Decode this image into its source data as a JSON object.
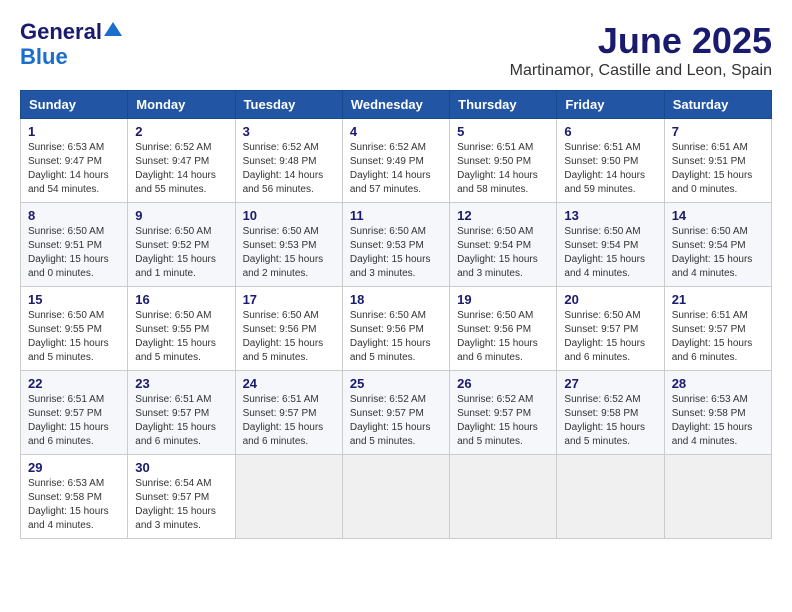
{
  "header": {
    "logo_line1": "General",
    "logo_line2": "Blue",
    "main_title": "June 2025",
    "subtitle": "Martinamor, Castille and Leon, Spain"
  },
  "calendar": {
    "headers": [
      "Sunday",
      "Monday",
      "Tuesday",
      "Wednesday",
      "Thursday",
      "Friday",
      "Saturday"
    ],
    "weeks": [
      [
        null,
        {
          "day": "2",
          "info": "Sunrise: 6:52 AM\nSunset: 9:47 PM\nDaylight: 14 hours\nand 55 minutes."
        },
        {
          "day": "3",
          "info": "Sunrise: 6:52 AM\nSunset: 9:48 PM\nDaylight: 14 hours\nand 56 minutes."
        },
        {
          "day": "4",
          "info": "Sunrise: 6:52 AM\nSunset: 9:49 PM\nDaylight: 14 hours\nand 57 minutes."
        },
        {
          "day": "5",
          "info": "Sunrise: 6:51 AM\nSunset: 9:50 PM\nDaylight: 14 hours\nand 58 minutes."
        },
        {
          "day": "6",
          "info": "Sunrise: 6:51 AM\nSunset: 9:50 PM\nDaylight: 14 hours\nand 59 minutes."
        },
        {
          "day": "7",
          "info": "Sunrise: 6:51 AM\nSunset: 9:51 PM\nDaylight: 15 hours\nand 0 minutes."
        }
      ],
      [
        {
          "day": "1",
          "info": "Sunrise: 6:53 AM\nSunset: 9:47 PM\nDaylight: 14 hours\nand 54 minutes."
        },
        {
          "day": "9",
          "info": "Sunrise: 6:50 AM\nSunset: 9:52 PM\nDaylight: 15 hours\nand 1 minute."
        },
        {
          "day": "10",
          "info": "Sunrise: 6:50 AM\nSunset: 9:53 PM\nDaylight: 15 hours\nand 2 minutes."
        },
        {
          "day": "11",
          "info": "Sunrise: 6:50 AM\nSunset: 9:53 PM\nDaylight: 15 hours\nand 3 minutes."
        },
        {
          "day": "12",
          "info": "Sunrise: 6:50 AM\nSunset: 9:54 PM\nDaylight: 15 hours\nand 3 minutes."
        },
        {
          "day": "13",
          "info": "Sunrise: 6:50 AM\nSunset: 9:54 PM\nDaylight: 15 hours\nand 4 minutes."
        },
        {
          "day": "14",
          "info": "Sunrise: 6:50 AM\nSunset: 9:54 PM\nDaylight: 15 hours\nand 4 minutes."
        }
      ],
      [
        {
          "day": "8",
          "info": "Sunrise: 6:50 AM\nSunset: 9:51 PM\nDaylight: 15 hours\nand 0 minutes."
        },
        {
          "day": "16",
          "info": "Sunrise: 6:50 AM\nSunset: 9:55 PM\nDaylight: 15 hours\nand 5 minutes."
        },
        {
          "day": "17",
          "info": "Sunrise: 6:50 AM\nSunset: 9:56 PM\nDaylight: 15 hours\nand 5 minutes."
        },
        {
          "day": "18",
          "info": "Sunrise: 6:50 AM\nSunset: 9:56 PM\nDaylight: 15 hours\nand 5 minutes."
        },
        {
          "day": "19",
          "info": "Sunrise: 6:50 AM\nSunset: 9:56 PM\nDaylight: 15 hours\nand 6 minutes."
        },
        {
          "day": "20",
          "info": "Sunrise: 6:50 AM\nSunset: 9:57 PM\nDaylight: 15 hours\nand 6 minutes."
        },
        {
          "day": "21",
          "info": "Sunrise: 6:51 AM\nSunset: 9:57 PM\nDaylight: 15 hours\nand 6 minutes."
        }
      ],
      [
        {
          "day": "15",
          "info": "Sunrise: 6:50 AM\nSunset: 9:55 PM\nDaylight: 15 hours\nand 5 minutes."
        },
        {
          "day": "23",
          "info": "Sunrise: 6:51 AM\nSunset: 9:57 PM\nDaylight: 15 hours\nand 6 minutes."
        },
        {
          "day": "24",
          "info": "Sunrise: 6:51 AM\nSunset: 9:57 PM\nDaylight: 15 hours\nand 6 minutes."
        },
        {
          "day": "25",
          "info": "Sunrise: 6:52 AM\nSunset: 9:57 PM\nDaylight: 15 hours\nand 5 minutes."
        },
        {
          "day": "26",
          "info": "Sunrise: 6:52 AM\nSunset: 9:57 PM\nDaylight: 15 hours\nand 5 minutes."
        },
        {
          "day": "27",
          "info": "Sunrise: 6:52 AM\nSunset: 9:58 PM\nDaylight: 15 hours\nand 5 minutes."
        },
        {
          "day": "28",
          "info": "Sunrise: 6:53 AM\nSunset: 9:58 PM\nDaylight: 15 hours\nand 4 minutes."
        }
      ],
      [
        {
          "day": "22",
          "info": "Sunrise: 6:51 AM\nSunset: 9:57 PM\nDaylight: 15 hours\nand 6 minutes."
        },
        {
          "day": "30",
          "info": "Sunrise: 6:54 AM\nSunset: 9:57 PM\nDaylight: 15 hours\nand 3 minutes."
        },
        null,
        null,
        null,
        null,
        null
      ],
      [
        {
          "day": "29",
          "info": "Sunrise: 6:53 AM\nSunset: 9:58 PM\nDaylight: 15 hours\nand 4 minutes."
        },
        null,
        null,
        null,
        null,
        null,
        null
      ]
    ]
  }
}
